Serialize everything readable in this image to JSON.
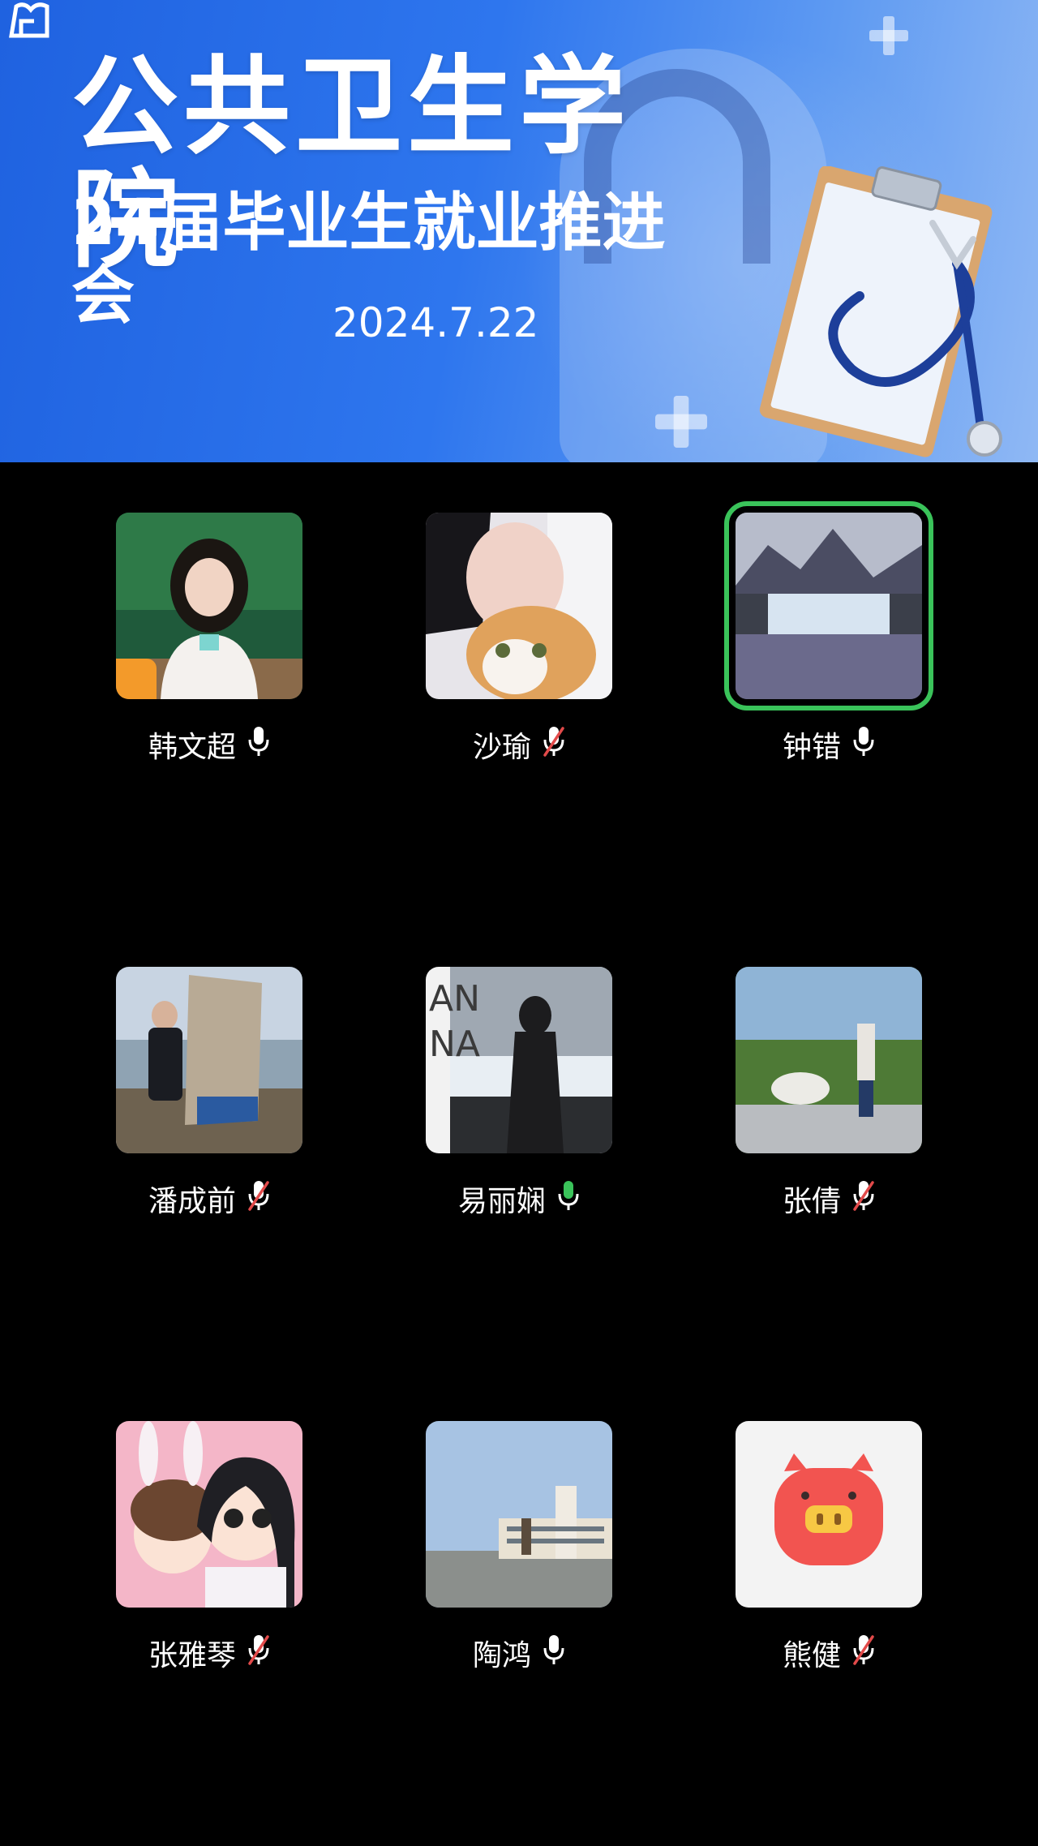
{
  "banner": {
    "title": "公共卫生学院",
    "subtitle": "24届毕业生就业推进会",
    "date": "2024.7.22"
  },
  "participants": [
    {
      "name": "韩文超",
      "mic": "on",
      "host": true,
      "speaking": false,
      "avatar": "photo-girl-forest"
    },
    {
      "name": "沙瑜",
      "mic": "muted",
      "host": false,
      "speaking": false,
      "avatar": "photo-girl-with-cat"
    },
    {
      "name": "钟错",
      "mic": "on",
      "host": false,
      "speaking": true,
      "avatar": "photo-waterfall-mountains"
    },
    {
      "name": "潘成前",
      "mic": "muted",
      "host": false,
      "speaking": false,
      "avatar": "photo-boy-by-stone"
    },
    {
      "name": "易丽娴",
      "mic": "active",
      "host": false,
      "speaking": false,
      "avatar": "photo-woman-silhouette-anna"
    },
    {
      "name": "张倩",
      "mic": "muted",
      "host": false,
      "speaking": false,
      "avatar": "photo-man-with-sheep"
    },
    {
      "name": "张雅琴",
      "mic": "muted",
      "host": false,
      "speaking": false,
      "avatar": "cartoon-two-girls"
    },
    {
      "name": "陶鸿",
      "mic": "on",
      "host": false,
      "speaking": false,
      "avatar": "photo-building-statue"
    },
    {
      "name": "熊健",
      "mic": "muted",
      "host": false,
      "speaking": false,
      "avatar": "cartoon-pig"
    }
  ],
  "colors": {
    "banner_blue": "#2e76ee",
    "speaking_border": "#3ac35a",
    "mic_active": "#3ac35a",
    "mic_muted_slash": "#e24a4a",
    "host_badge": "#f39a2a"
  }
}
